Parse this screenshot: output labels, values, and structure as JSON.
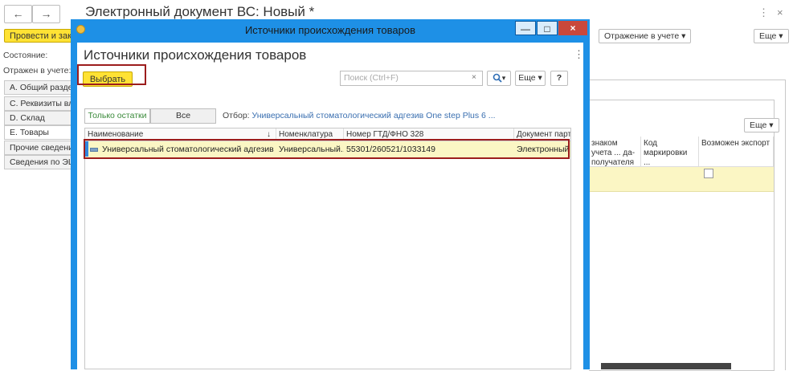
{
  "background_window": {
    "nav_back": "←",
    "nav_forward": "→",
    "title": "Электронный документ ВС: Новый *",
    "more_icon": "⋮",
    "close_icon": "×",
    "post_button": "Провести и закрыть",
    "state_label": "Состояние:",
    "reflected_label": "Отражен в учете:",
    "reflection_button": "Отражение в учете",
    "more_button": "Еще",
    "more_button_2": "Еще",
    "tabs": [
      "А. Общий раздел",
      "С. Реквизиты владельца",
      "D. Склад",
      "E. Товары",
      "Прочие сведения",
      "Сведения по ЭЦП"
    ],
    "columns": [
      "знаком учета ... да-получателя",
      "Код маркировки ...",
      "Возможен экспорт"
    ]
  },
  "modal": {
    "window_title": "Источники происхождения товаров",
    "minimize": "—",
    "maximize": "□",
    "close": "×",
    "form_title": "Источники происхождения товаров",
    "more_menu": "⋮",
    "select_button": "Выбрать",
    "search_placeholder": "Поиск (Ctrl+F)",
    "search_clear": "×",
    "search_icon": "🔍▾",
    "more_button": "Еще ▾",
    "help_button": "?",
    "toggle_remainders": "Только остатки",
    "toggle_all": "Все",
    "filter_label": "Отбор:",
    "filter_value": "Универсальный стоматологический адгезив One step Plus 6 ...",
    "grid": {
      "columns": [
        "Наименование",
        "Номенклатура",
        "Номер ГТД/ФНО 328",
        "Документ партии"
      ],
      "sort_indicator": "↓",
      "rows": [
        {
          "name": "Универсальный стоматологический адгезив О...",
          "nomenclature": "Универсальный...",
          "gtd": "55301/260521/1033149",
          "document": "Электронный д"
        }
      ]
    }
  }
}
